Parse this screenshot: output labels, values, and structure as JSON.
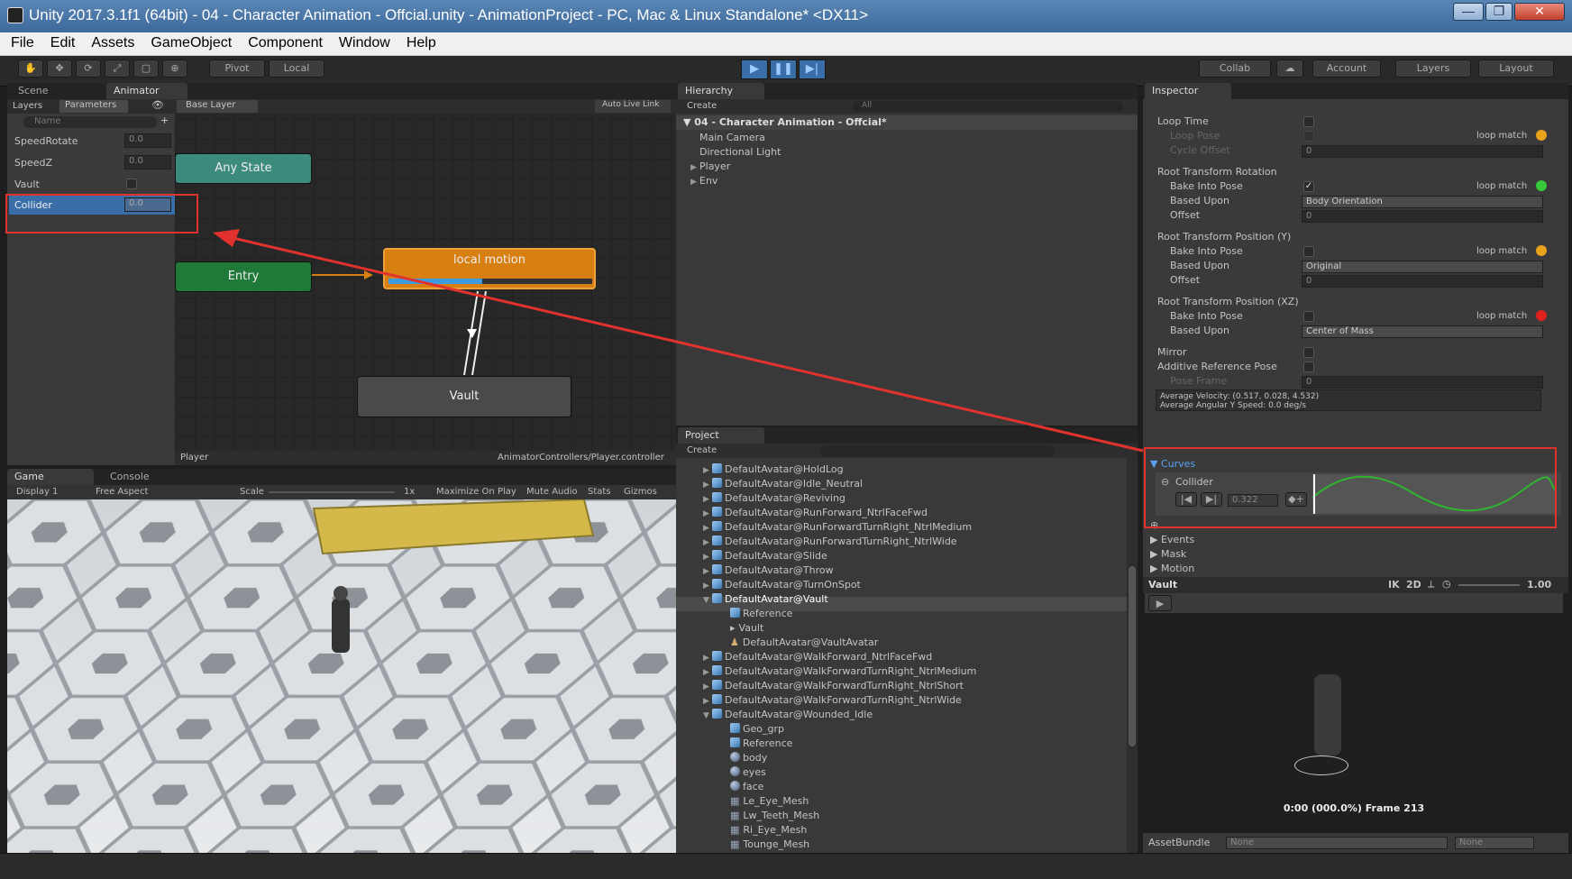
{
  "window": {
    "title": "Unity 2017.3.1f1 (64bit) - 04 - Character Animation - Offcial.unity - AnimationProject - PC, Mac & Linux Standalone* <DX11>",
    "min": "—",
    "max": "❐",
    "close": "✕"
  },
  "menu": [
    "File",
    "Edit",
    "Assets",
    "GameObject",
    "Component",
    "Window",
    "Help"
  ],
  "toolbar": {
    "pivot": "Pivot",
    "local": "Local",
    "collab": "Collab",
    "account": "Account",
    "layers": "Layers",
    "layout": "Layout",
    "play": "▶",
    "pause": "❚❚",
    "step": "▶|"
  },
  "animator": {
    "tabs": [
      "Scene",
      "Animator"
    ],
    "subtabs": [
      "Layers",
      "Parameters"
    ],
    "search_placeholder": "Name",
    "base_layer": "Base Layer",
    "auto_live_link": "Auto Live Link",
    "params": [
      {
        "name": "SpeedRotate",
        "value": "0.0"
      },
      {
        "name": "SpeedZ",
        "value": "0.0"
      },
      {
        "name": "Vault",
        "value": ""
      },
      {
        "name": "Collider",
        "value": "0.0"
      }
    ],
    "nodes": {
      "any_state": "Any State",
      "entry": "Entry",
      "local_motion": "local motion",
      "vault": "Vault"
    },
    "footer_left": "Player",
    "footer_right": "AnimatorControllers/Player.controller"
  },
  "game": {
    "tabs": [
      "Game",
      "Console"
    ],
    "display": "Display 1",
    "aspect": "Free Aspect",
    "scale_label": "Scale",
    "scale_value": "1x",
    "toggles": [
      "Maximize On Play",
      "Mute Audio",
      "Stats",
      "Gizmos"
    ]
  },
  "hierarchy": {
    "tab": "Hierarchy",
    "create": "Create",
    "search": "All",
    "scene": "04 - Character Animation - Offcial*",
    "items": [
      {
        "label": "Main Camera",
        "arrow": ""
      },
      {
        "label": "Directional Light",
        "arrow": ""
      },
      {
        "label": "Player",
        "arrow": "▶"
      },
      {
        "label": "Env",
        "arrow": "▶"
      }
    ]
  },
  "project": {
    "tab": "Project",
    "create": "Create",
    "items": [
      {
        "label": "DefaultAvatar@HoldLog",
        "indent": 0,
        "arrow": "▶",
        "icon": "cube"
      },
      {
        "label": "DefaultAvatar@Idle_Neutral",
        "indent": 0,
        "arrow": "▶",
        "icon": "cube"
      },
      {
        "label": "DefaultAvatar@Reviving",
        "indent": 0,
        "arrow": "▶",
        "icon": "cube"
      },
      {
        "label": "DefaultAvatar@RunForward_NtrlFaceFwd",
        "indent": 0,
        "arrow": "▶",
        "icon": "cube"
      },
      {
        "label": "DefaultAvatar@RunForwardTurnRight_NtrlMedium",
        "indent": 0,
        "arrow": "▶",
        "icon": "cube"
      },
      {
        "label": "DefaultAvatar@RunForwardTurnRight_NtrlWide",
        "indent": 0,
        "arrow": "▶",
        "icon": "cube"
      },
      {
        "label": "DefaultAvatar@Slide",
        "indent": 0,
        "arrow": "▶",
        "icon": "cube"
      },
      {
        "label": "DefaultAvatar@Throw",
        "indent": 0,
        "arrow": "▶",
        "icon": "cube"
      },
      {
        "label": "DefaultAvatar@TurnOnSpot",
        "indent": 0,
        "arrow": "▶",
        "icon": "cube"
      },
      {
        "label": "DefaultAvatar@Vault",
        "indent": 0,
        "arrow": "▼",
        "icon": "cube",
        "selected": true
      },
      {
        "label": "Reference",
        "indent": 1,
        "arrow": "",
        "icon": "cube"
      },
      {
        "label": "Vault",
        "indent": 1,
        "arrow": "",
        "icon": "clip"
      },
      {
        "label": "DefaultAvatar@VaultAvatar",
        "indent": 1,
        "arrow": "",
        "icon": "avatar"
      },
      {
        "label": "DefaultAvatar@WalkForward_NtrlFaceFwd",
        "indent": 0,
        "arrow": "▶",
        "icon": "cube"
      },
      {
        "label": "DefaultAvatar@WalkForwardTurnRight_NtrlMedium",
        "indent": 0,
        "arrow": "▶",
        "icon": "cube"
      },
      {
        "label": "DefaultAvatar@WalkForwardTurnRight_NtrlShort",
        "indent": 0,
        "arrow": "▶",
        "icon": "cube"
      },
      {
        "label": "DefaultAvatar@WalkForwardTurnRight_NtrlWide",
        "indent": 0,
        "arrow": "▶",
        "icon": "cube"
      },
      {
        "label": "DefaultAvatar@Wounded_Idle",
        "indent": 0,
        "arrow": "▼",
        "icon": "cube"
      },
      {
        "label": "Geo_grp",
        "indent": 1,
        "arrow": "",
        "icon": "cube"
      },
      {
        "label": "Reference",
        "indent": 1,
        "arrow": "",
        "icon": "cube"
      },
      {
        "label": "body",
        "indent": 1,
        "arrow": "",
        "icon": "sphere"
      },
      {
        "label": "eyes",
        "indent": 1,
        "arrow": "",
        "icon": "sphere"
      },
      {
        "label": "face",
        "indent": 1,
        "arrow": "",
        "icon": "sphere"
      },
      {
        "label": "Le_Eye_Mesh",
        "indent": 1,
        "arrow": "",
        "icon": "grid"
      },
      {
        "label": "Lw_Teeth_Mesh",
        "indent": 1,
        "arrow": "",
        "icon": "grid"
      },
      {
        "label": "Ri_Eye_Mesh",
        "indent": 1,
        "arrow": "",
        "icon": "grid"
      },
      {
        "label": "Tounge_Mesh",
        "indent": 1,
        "arrow": "",
        "icon": "grid"
      }
    ]
  },
  "inspector": {
    "tab": "Inspector",
    "loop_time": "Loop Time",
    "loop_pose": "Loop Pose",
    "cycle_offset": "Cycle Offset",
    "cycle_offset_value": "0",
    "loop_match": "loop match",
    "rtr_title": "Root Transform Rotation",
    "rty_title": "Root Transform Position (Y)",
    "rtxz_title": "Root Transform Position (XZ)",
    "bake_into_pose": "Bake Into Pose",
    "based_upon": "Based Upon",
    "offset": "Offset",
    "rtr_based": "Body Orientation",
    "rtr_offset": "0",
    "rty_based": "Original",
    "rty_offset": "0",
    "rtxz_based": "Center of Mass",
    "mirror": "Mirror",
    "additive": "Additive Reference Pose",
    "pose_frame": "Pose Frame",
    "pose_frame_value": "0",
    "avg_velocity": "Average Velocity: (0.517, 0.028, 4.532)",
    "avg_angular": "Average Angular Y Speed: 0.0 deg/s",
    "curves": "Curves",
    "curve_name": "Collider",
    "curve_value": "0.322",
    "events": "Events",
    "mask": "Mask",
    "motion": "Motion",
    "preview_name": "Vault",
    "ik": "IK",
    "two_d": "2D",
    "speed": "1.00",
    "frame": "0:00 (000.0%) Frame 213",
    "asset_bundle": "AssetBundle",
    "none1": "None",
    "none2": "None",
    "loop_colors": {
      "loop_pose": "#e8a21c",
      "rotation": "#37c93a",
      "pos_y": "#e8a21c",
      "pos_xz": "#e0201e"
    }
  }
}
